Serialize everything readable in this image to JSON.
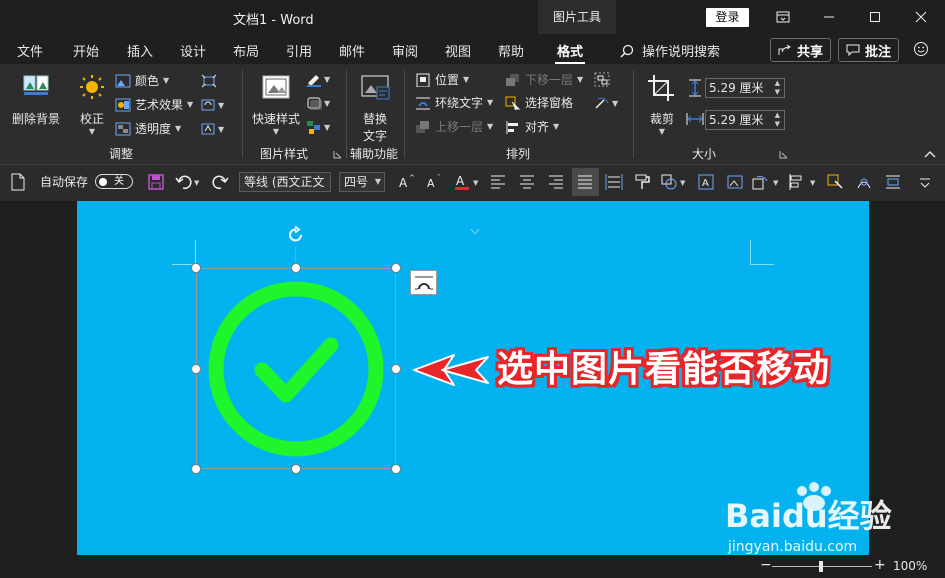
{
  "window": {
    "doc_title": "文档1  -  Word",
    "context_tab": "图片工具",
    "login_label": "登录"
  },
  "tabs": [
    {
      "label": "文件"
    },
    {
      "label": "开始"
    },
    {
      "label": "插入"
    },
    {
      "label": "设计"
    },
    {
      "label": "布局"
    },
    {
      "label": "引用"
    },
    {
      "label": "邮件"
    },
    {
      "label": "审阅"
    },
    {
      "label": "视图"
    },
    {
      "label": "帮助"
    },
    {
      "label": "格式",
      "active": true
    }
  ],
  "search": {
    "label": "操作说明搜索"
  },
  "share_label": "共享",
  "comment_label": "批注",
  "ribbon": {
    "adjust": {
      "remove_bg": "删除背景",
      "correct": "校正",
      "color": "颜色",
      "art_effects": "艺术效果",
      "transparency": "透明度",
      "group_label": "调整"
    },
    "picture_styles": {
      "quick_styles": "快速样式",
      "group_label": "图片样式"
    },
    "accessibility": {
      "alt_text_line1": "替换",
      "alt_text_line2": "文字",
      "group_label": "辅助功能"
    },
    "arrange": {
      "position": "位置",
      "wrap_text": "环绕文字",
      "bring_forward": "上移一层",
      "send_backward": "下移一层",
      "selection_pane": "选择窗格",
      "align": "对齐",
      "group_label": "排列"
    },
    "size": {
      "crop": "裁剪",
      "height": "5.29 厘米",
      "width": "5.29 厘米",
      "group_label": "大小"
    }
  },
  "qat": {
    "autosave_label": "自动保存",
    "autosave_state": "关",
    "font_name": "等线 (西文正文",
    "font_size": "四号"
  },
  "document": {
    "annotation": "选中图片看能否移动"
  },
  "status": {
    "zoom": "100%",
    "zoom_fraction": 0.5
  },
  "watermark": {
    "brand": "Baidu经验",
    "url": "jingyan.baidu.com"
  },
  "colors": {
    "page_bg": "#03b2ee",
    "check_green": "#1ef52b",
    "arrow_red": "#e8262a"
  }
}
